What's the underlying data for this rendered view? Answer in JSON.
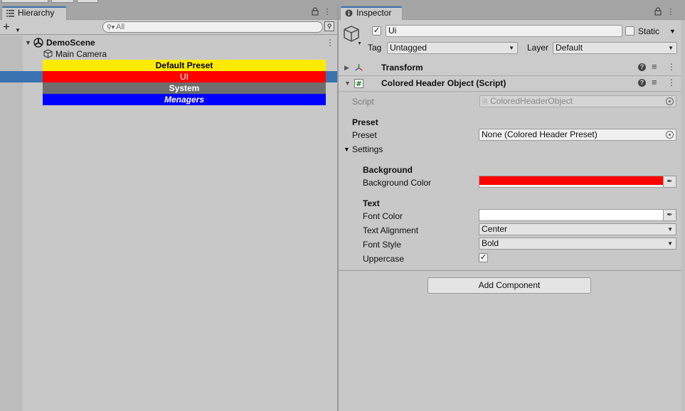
{
  "hierarchy": {
    "tab_label": "Hierarchy",
    "search_placeholder": "All",
    "scene": {
      "name": "DemoScene"
    },
    "items": [
      {
        "label": "Main Camera"
      }
    ],
    "headers": [
      {
        "label": "Default Preset",
        "bg": "#ffeb00",
        "fg": "#000000",
        "style": "bold"
      },
      {
        "label": "UI",
        "bg": "#ff0000",
        "fg": "#ffffff",
        "style": "normal"
      },
      {
        "label": "System",
        "bg": "#6e6e6e",
        "fg": "#ffffff",
        "style": "bold"
      },
      {
        "label": "Menagers",
        "bg": "#0000ff",
        "fg": "#ffffff",
        "style": "bold-italic"
      }
    ],
    "selected_index": 1
  },
  "inspector": {
    "tab_label": "Inspector",
    "object": {
      "active_checked": true,
      "name": "Ui",
      "static_label": "Static",
      "static_checked": false,
      "tag_label": "Tag",
      "tag_value": "Untagged",
      "layer_label": "Layer",
      "layer_value": "Default"
    },
    "components": {
      "transform": {
        "title": "Transform"
      },
      "header_script": {
        "title": "Colored Header Object (Script)"
      }
    },
    "script": {
      "label": "Script",
      "value": "ColoredHeaderObject"
    },
    "preset_section": {
      "heading": "Preset",
      "label": "Preset",
      "value": "None (Colored Header Preset)"
    },
    "settings": {
      "foldout_label": "Settings",
      "background_heading": "Background",
      "background_color_label": "Background Color",
      "background_color": "#ff0000",
      "text_heading": "Text",
      "font_color_label": "Font Color",
      "font_color": "#ffffff",
      "text_alignment_label": "Text Alignment",
      "text_alignment_value": "Center",
      "font_style_label": "Font Style",
      "font_style_value": "Bold",
      "uppercase_label": "Uppercase",
      "uppercase_checked": true
    },
    "add_component_label": "Add Component"
  },
  "colors": {
    "selection": "#3a72b0",
    "panel_bg": "#c8c8c8"
  }
}
